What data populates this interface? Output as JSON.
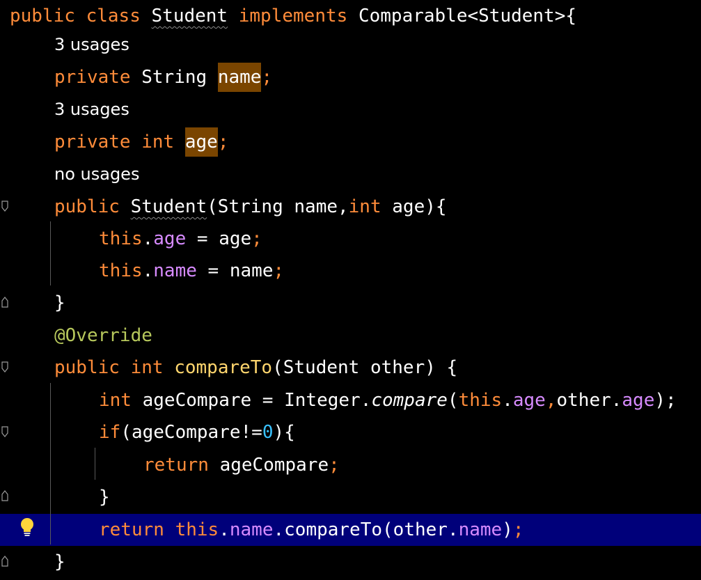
{
  "editor": {
    "inlay_hints": {
      "name_usages": "3 usages",
      "age_usages": "3 usages",
      "ctor_usages": "no usages"
    },
    "lines": {
      "l1": [
        "public",
        " ",
        "class",
        " ",
        "Student",
        " ",
        "implements",
        " ",
        "Comparable<Student>{"
      ],
      "l3": [
        "private",
        " ",
        "String",
        " ",
        "name",
        ";"
      ],
      "l5": [
        "private",
        " ",
        "int",
        " ",
        "age",
        ";"
      ],
      "l7": [
        "public",
        " ",
        "Student",
        "(String name,",
        "int",
        " age){"
      ],
      "l8": [
        "this",
        ".",
        "age",
        " = age",
        ";"
      ],
      "l9": [
        "this",
        ".",
        "name",
        " = name",
        ";"
      ],
      "l10": [
        "}"
      ],
      "l11": [
        "@Override"
      ],
      "l12": [
        "public",
        " ",
        "int",
        " ",
        "compareTo",
        "(Student other) {"
      ],
      "l13": [
        "int",
        " ageCompare = Integer.",
        "compare",
        "(",
        "this",
        ".",
        "age",
        ",",
        "other.",
        "age",
        ");"
      ],
      "l14": [
        "if",
        "(ageCompare!=",
        "0",
        "){"
      ],
      "l15": [
        "return",
        " ageCompare",
        ";"
      ],
      "l16": [
        "}"
      ],
      "l17": [
        "return",
        " ",
        "this",
        ".",
        "name",
        ".compareTo(other.",
        "name",
        ")",
        ";"
      ],
      "l18": [
        "}"
      ]
    },
    "colors": {
      "background": "#000000",
      "keyword": "#ff8c3a",
      "field": "#d78bff",
      "method_decl": "#ffd66e",
      "annotation": "#b7c85c",
      "number": "#39c2ff",
      "occurrence_highlight": "#7a4500",
      "current_line": "#00007a"
    },
    "gutter": {
      "lightbulb_icon": "lightbulb-icon",
      "fold_icon": "fold-marker-icon"
    }
  }
}
